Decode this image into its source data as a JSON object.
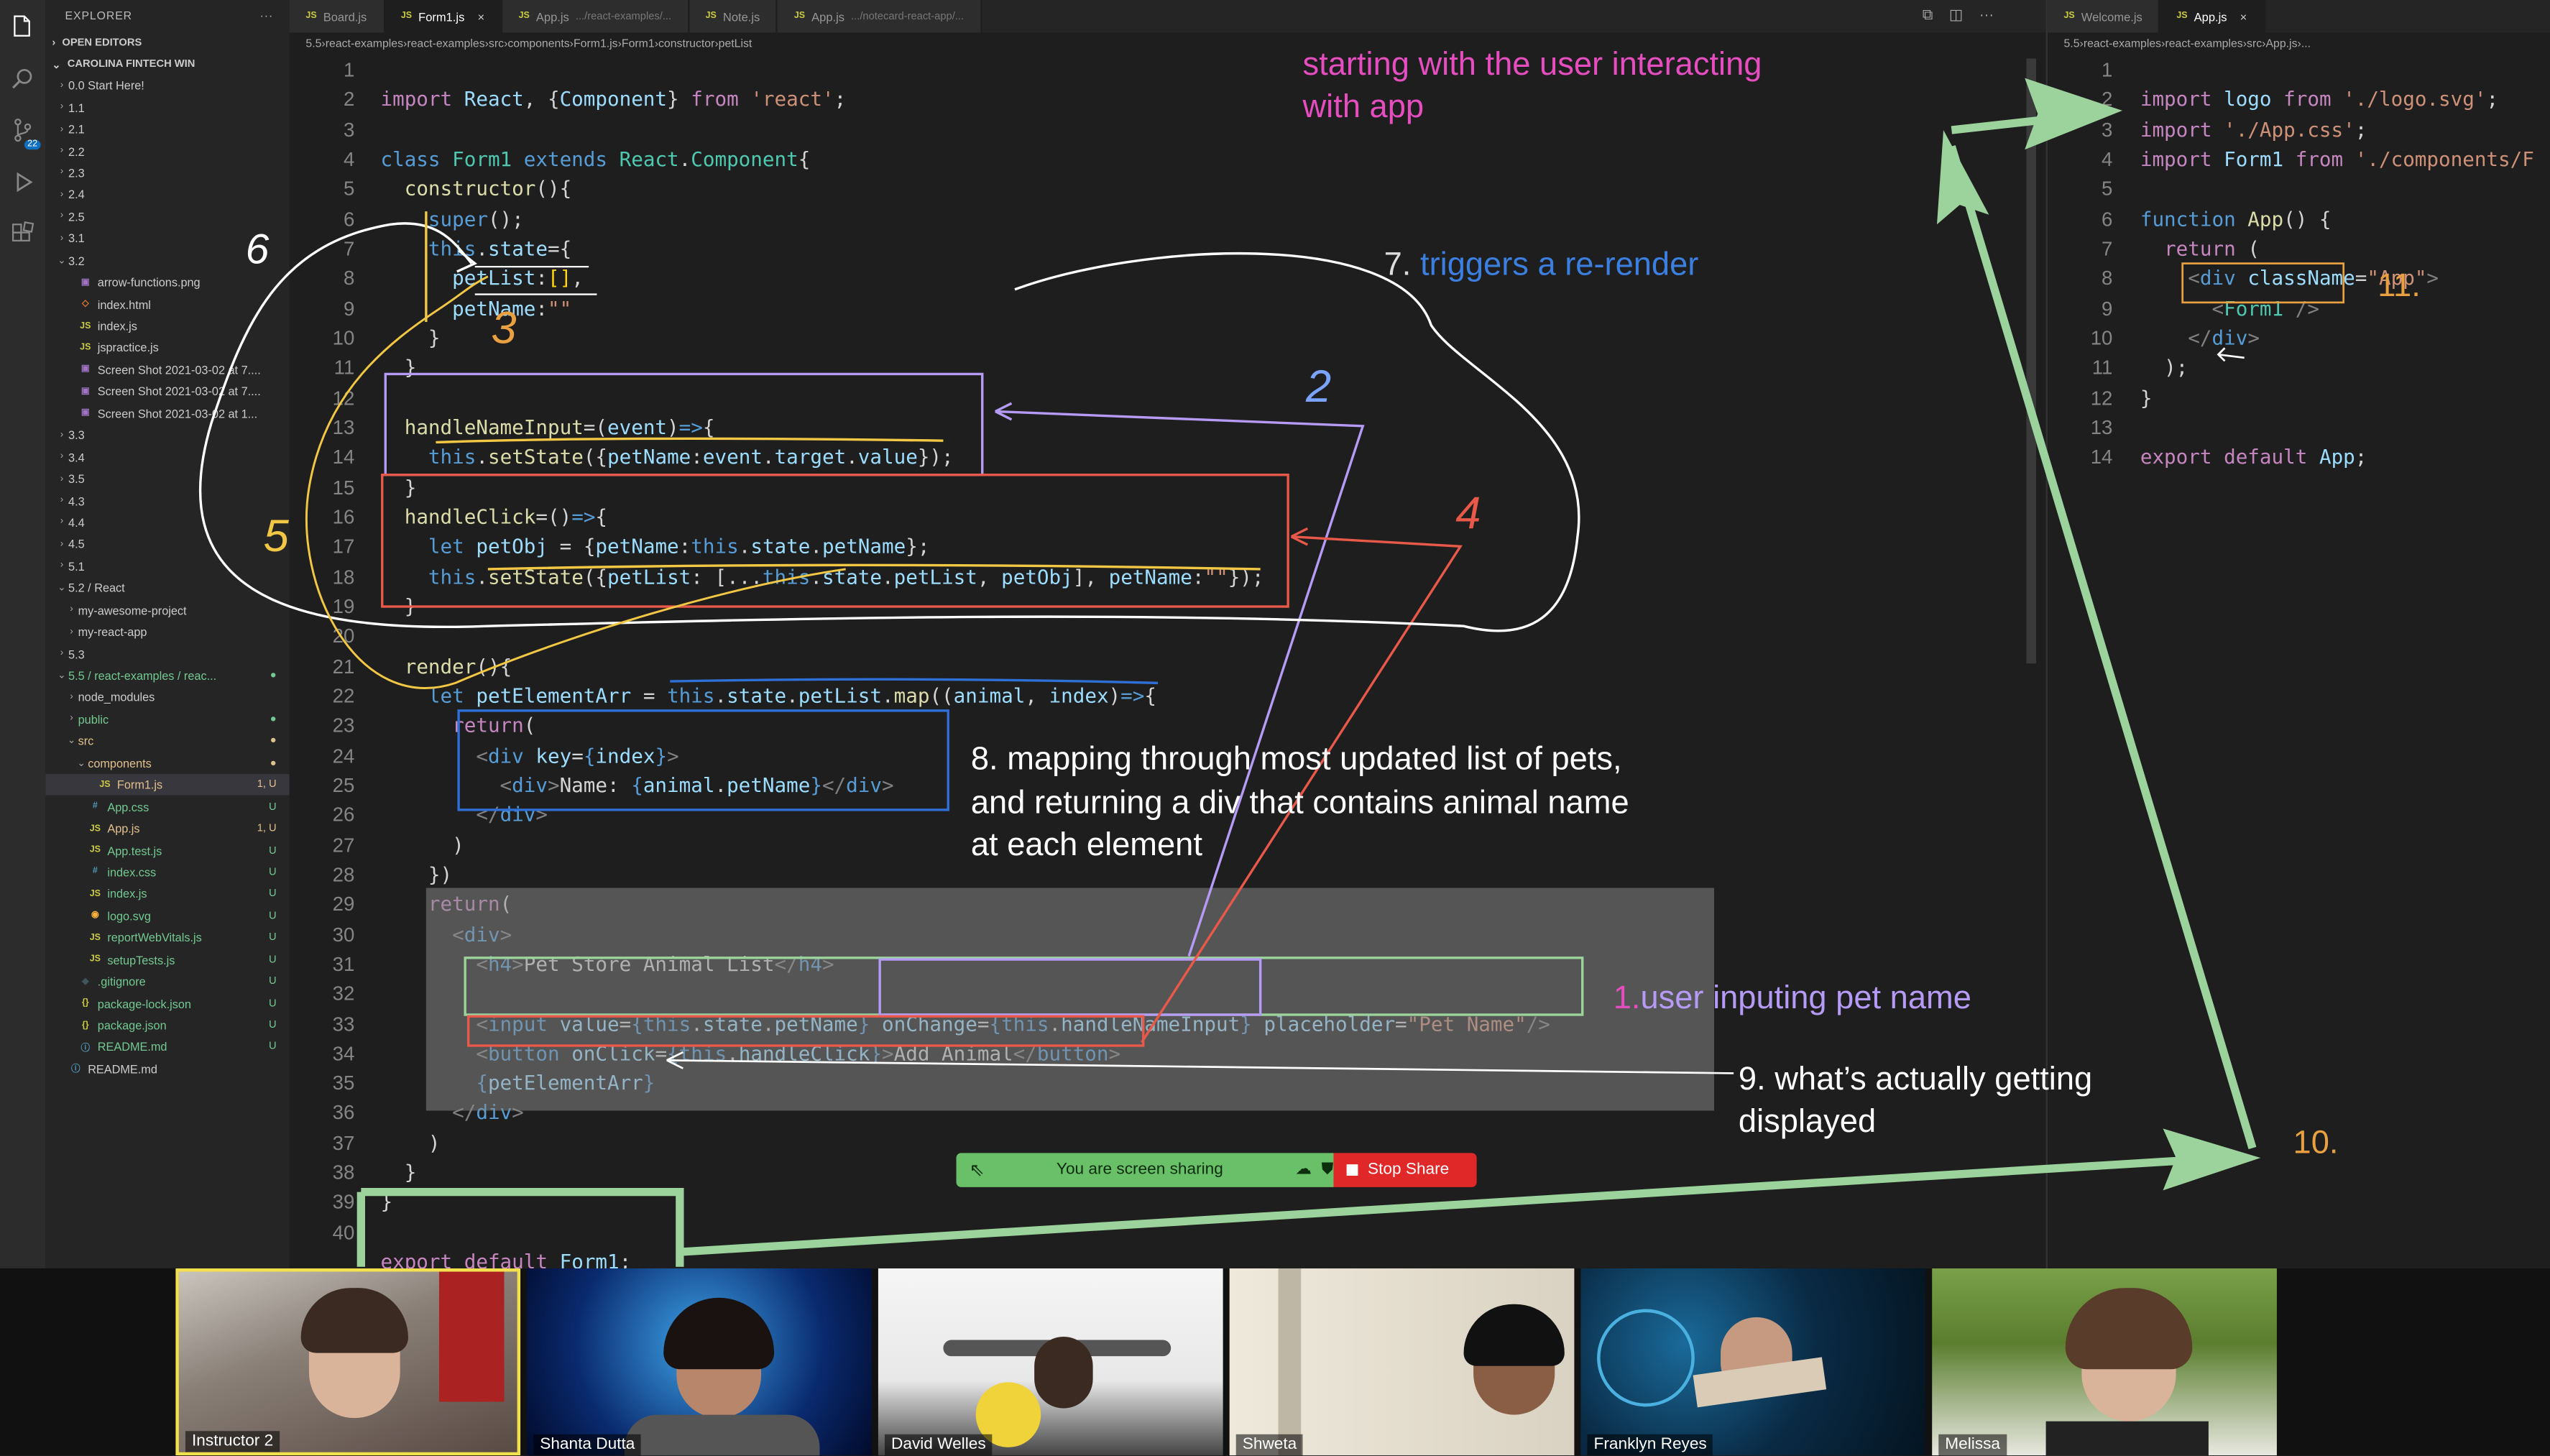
{
  "explorer": {
    "title": "EXPLORER",
    "open_editors": "OPEN EDITORS",
    "workspace": "CAROLINA FINTECH WIN",
    "items": [
      {
        "label": "0.0 Start Here!",
        "indent": 1,
        "caret": "›",
        "icon": "",
        "badge": "",
        "color": "#ccc"
      },
      {
        "label": "1.1",
        "indent": 1,
        "caret": "›",
        "icon": "",
        "badge": "",
        "color": "#ccc"
      },
      {
        "label": "2.1",
        "indent": 1,
        "caret": "›",
        "icon": "",
        "badge": "",
        "color": "#ccc"
      },
      {
        "label": "2.2",
        "indent": 1,
        "caret": "›",
        "icon": "",
        "badge": "",
        "color": "#ccc"
      },
      {
        "label": "2.3",
        "indent": 1,
        "caret": "›",
        "icon": "",
        "badge": "",
        "color": "#ccc"
      },
      {
        "label": "2.4",
        "indent": 1,
        "caret": "›",
        "icon": "",
        "badge": "",
        "color": "#ccc"
      },
      {
        "label": "2.5",
        "indent": 1,
        "caret": "›",
        "icon": "",
        "badge": "",
        "color": "#ccc"
      },
      {
        "label": "3.1",
        "indent": 1,
        "caret": "›",
        "icon": "",
        "badge": "",
        "color": "#ccc"
      },
      {
        "label": "3.2",
        "indent": 1,
        "caret": "⌄",
        "icon": "",
        "badge": "",
        "color": "#ccc"
      },
      {
        "label": "arrow-functions.png",
        "indent": 2,
        "caret": "",
        "icon": "img",
        "badge": "",
        "color": "#ccc"
      },
      {
        "label": "index.html",
        "indent": 2,
        "caret": "",
        "icon": "html",
        "badge": "",
        "color": "#ccc"
      },
      {
        "label": "index.js",
        "indent": 2,
        "caret": "",
        "icon": "js",
        "badge": "",
        "color": "#ccc"
      },
      {
        "label": "jspractice.js",
        "indent": 2,
        "caret": "",
        "icon": "js",
        "badge": "",
        "color": "#ccc"
      },
      {
        "label": "Screen Shot 2021-03-02 at 7....",
        "indent": 2,
        "caret": "",
        "icon": "img",
        "badge": "",
        "color": "#ccc"
      },
      {
        "label": "Screen Shot 2021-03-02 at 7....",
        "indent": 2,
        "caret": "",
        "icon": "img",
        "badge": "",
        "color": "#ccc"
      },
      {
        "label": "Screen Shot 2021-03-02 at 1...",
        "indent": 2,
        "caret": "",
        "icon": "img",
        "badge": "",
        "color": "#ccc"
      },
      {
        "label": "3.3",
        "indent": 1,
        "caret": "›",
        "icon": "",
        "badge": "",
        "color": "#ccc"
      },
      {
        "label": "3.4",
        "indent": 1,
        "caret": "›",
        "icon": "",
        "badge": "",
        "color": "#ccc"
      },
      {
        "label": "3.5",
        "indent": 1,
        "caret": "›",
        "icon": "",
        "badge": "",
        "color": "#ccc"
      },
      {
        "label": "4.3",
        "indent": 1,
        "caret": "›",
        "icon": "",
        "badge": "",
        "color": "#ccc"
      },
      {
        "label": "4.4",
        "indent": 1,
        "caret": "›",
        "icon": "",
        "badge": "",
        "color": "#ccc"
      },
      {
        "label": "4.5",
        "indent": 1,
        "caret": "›",
        "icon": "",
        "badge": "",
        "color": "#ccc"
      },
      {
        "label": "5.1",
        "indent": 1,
        "caret": "›",
        "icon": "",
        "badge": "",
        "color": "#ccc"
      },
      {
        "label": "5.2 / React",
        "indent": 1,
        "caret": "⌄",
        "icon": "",
        "badge": "",
        "color": "#ccc"
      },
      {
        "label": "my-awesome-project",
        "indent": 2,
        "caret": "›",
        "icon": "",
        "badge": "",
        "color": "#ccc"
      },
      {
        "label": "my-react-app",
        "indent": 2,
        "caret": "›",
        "icon": "",
        "badge": "",
        "color": "#ccc"
      },
      {
        "label": "5.3",
        "indent": 1,
        "caret": "›",
        "icon": "",
        "badge": "",
        "color": "#ccc"
      },
      {
        "label": "5.5 / react-examples / reac...",
        "indent": 1,
        "caret": "⌄",
        "icon": "",
        "badge": "●",
        "color": "#73c991"
      },
      {
        "label": "node_modules",
        "indent": 2,
        "caret": "›",
        "icon": "",
        "badge": "",
        "color": "#ccc"
      },
      {
        "label": "public",
        "indent": 2,
        "caret": "›",
        "icon": "",
        "badge": "●",
        "color": "#73c991"
      },
      {
        "label": "src",
        "indent": 2,
        "caret": "⌄",
        "icon": "",
        "badge": "●",
        "color": "#e2c08d"
      },
      {
        "label": "components",
        "indent": 3,
        "caret": "⌄",
        "icon": "",
        "badge": "●",
        "color": "#e2c08d"
      },
      {
        "label": "Form1.js",
        "indent": 4,
        "caret": "",
        "icon": "js",
        "badge": "1, U",
        "color": "#e2c08d",
        "selected": true
      },
      {
        "label": "App.css",
        "indent": 3,
        "caret": "",
        "icon": "css",
        "badge": "U",
        "color": "#73c991"
      },
      {
        "label": "App.js",
        "indent": 3,
        "caret": "",
        "icon": "js",
        "badge": "1, U",
        "color": "#e2c08d"
      },
      {
        "label": "App.test.js",
        "indent": 3,
        "caret": "",
        "icon": "js",
        "badge": "U",
        "color": "#73c991"
      },
      {
        "label": "index.css",
        "indent": 3,
        "caret": "",
        "icon": "css",
        "badge": "U",
        "color": "#73c991"
      },
      {
        "label": "index.js",
        "indent": 3,
        "caret": "",
        "icon": "js",
        "badge": "U",
        "color": "#73c991"
      },
      {
        "label": "logo.svg",
        "indent": 3,
        "caret": "",
        "icon": "svg",
        "badge": "U",
        "color": "#73c991"
      },
      {
        "label": "reportWebVitals.js",
        "indent": 3,
        "caret": "",
        "icon": "js",
        "badge": "U",
        "color": "#73c991"
      },
      {
        "label": "setupTests.js",
        "indent": 3,
        "caret": "",
        "icon": "js",
        "badge": "U",
        "color": "#73c991"
      },
      {
        "label": ".gitignore",
        "indent": 2,
        "caret": "",
        "icon": "git",
        "badge": "U",
        "color": "#73c991"
      },
      {
        "label": "package-lock.json",
        "indent": 2,
        "caret": "",
        "icon": "json",
        "badge": "U",
        "color": "#73c991"
      },
      {
        "label": "package.json",
        "indent": 2,
        "caret": "",
        "icon": "json",
        "badge": "U",
        "color": "#73c991"
      },
      {
        "label": "README.md",
        "indent": 2,
        "caret": "",
        "icon": "info",
        "badge": "U",
        "color": "#73c991"
      },
      {
        "label": "README.md",
        "indent": 1,
        "caret": "",
        "icon": "info",
        "badge": "",
        "color": "#ccc"
      }
    ]
  },
  "tabs": [
    {
      "label": "Board.js",
      "sub": "",
      "active": false
    },
    {
      "label": "Form1.js",
      "sub": "",
      "active": true
    },
    {
      "label": "App.js",
      "sub": ".../react-examples/...",
      "active": false
    },
    {
      "label": "Note.js",
      "sub": "",
      "active": false
    },
    {
      "label": "App.js",
      "sub": ".../notecard-react-app/...",
      "active": false
    }
  ],
  "right_tabs": [
    {
      "label": "Welcome.js",
      "sub": "",
      "active": false
    },
    {
      "label": "App.js",
      "sub": "",
      "active": true
    }
  ],
  "breadcrumb": [
    "5.5",
    "react-examples",
    "react-examples",
    "src",
    "components",
    "Form1.js",
    "Form1",
    "constructor",
    "petList"
  ],
  "right_breadcrumb": [
    "5.5",
    "react-examples",
    "react-examples",
    "src",
    "App.js",
    "..."
  ],
  "line_numbers": [
    "1",
    "2",
    "3",
    "4",
    "5",
    "6",
    "7",
    "8",
    "9",
    "10",
    "11",
    "12",
    "13",
    "14",
    "15",
    "16",
    "17",
    "18",
    "19",
    "20",
    "21",
    "22",
    "23",
    "24",
    "25",
    "26",
    "27",
    "28",
    "29",
    "30",
    "31",
    "32",
    "33",
    "34",
    "35",
    "36",
    "37",
    "38",
    "39",
    "40"
  ],
  "right_line_numbers": [
    "1",
    "2",
    "3",
    "4",
    "5",
    "6",
    "7",
    "8",
    "9",
    "10",
    "11",
    "12",
    "13",
    "14"
  ],
  "annotations": {
    "intro": "starting with the user interacting\nwith app",
    "a7_num": "7. ",
    "a7_text": "triggers a re-render",
    "a8": "8. mapping through most updated list of pets,\nand returning a div that contains animal name\nat each element",
    "a1_num": "1.",
    "a1_text": "user inputing pet name",
    "a9": "9. what’s actually getting\ndisplayed",
    "a10": "10.",
    "a11": "11.",
    "h2": "2",
    "h3": "3",
    "h4": "4",
    "h5": "5",
    "h6": "6"
  },
  "share_bar": {
    "status": "You are screen sharing",
    "stop": "Stop Share"
  },
  "participants": [
    "Instructor 2",
    "Shanta Dutta",
    "David Welles",
    "Shweta",
    "Franklyn Reyes",
    "Melissa"
  ],
  "scm_badge": "22",
  "colors": {
    "accent": "#569cd6",
    "green_arrow": "#9cd39c",
    "orange": "#e8594a",
    "purple": "#b59bf5",
    "yellow": "#f2c744",
    "blue_box": "#2f6fd8"
  }
}
